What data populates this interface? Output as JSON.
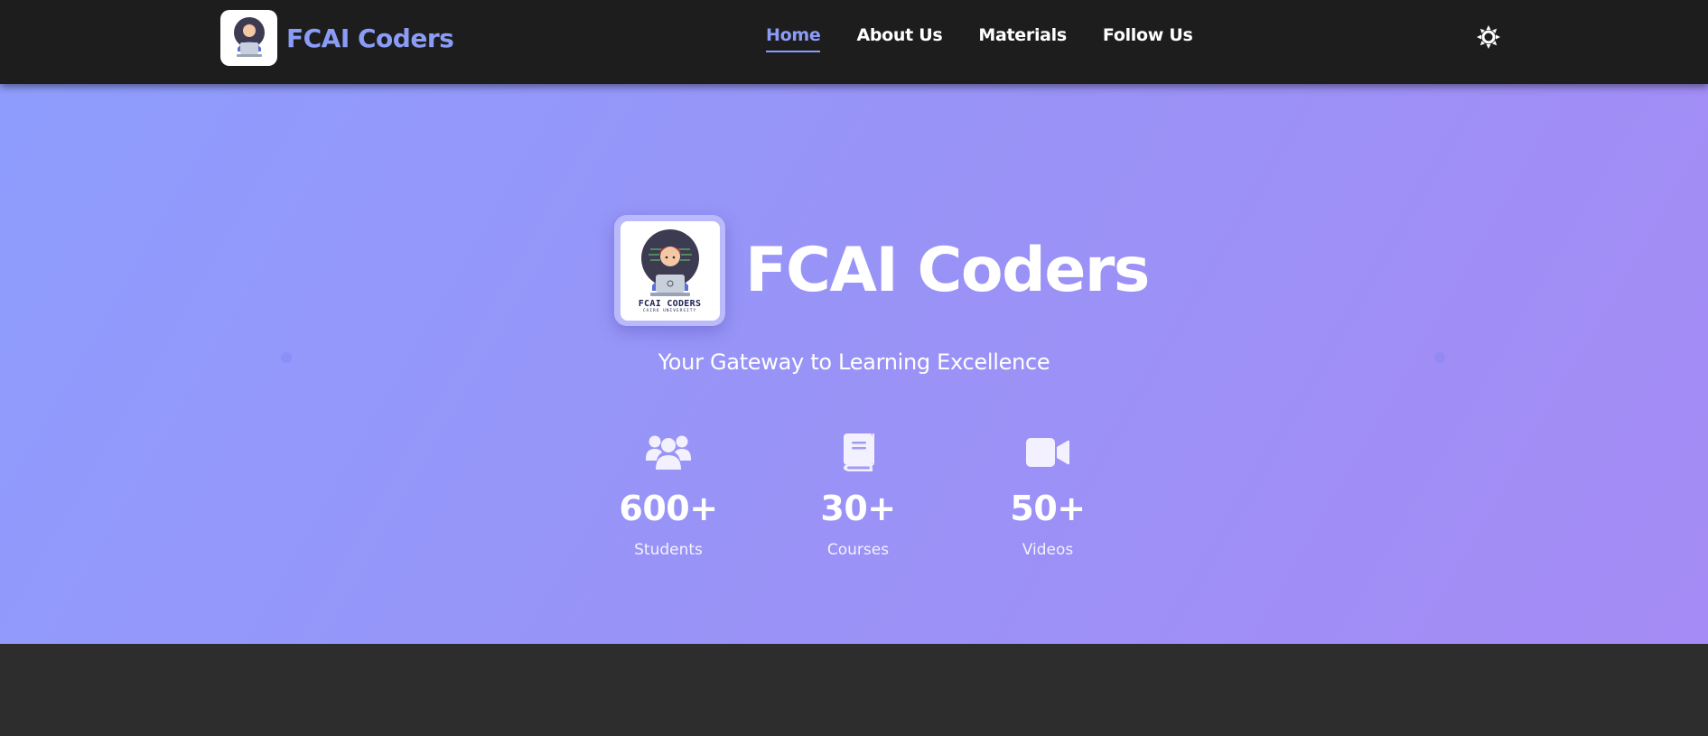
{
  "brand": {
    "name": "FCAI Coders"
  },
  "nav": {
    "items": [
      {
        "label": "Home",
        "active": true
      },
      {
        "label": "About Us",
        "active": false
      },
      {
        "label": "Materials",
        "active": false
      },
      {
        "label": "Follow Us",
        "active": false
      }
    ],
    "theme_toggle_icon": "sun-icon"
  },
  "hero": {
    "title": "FCAI Coders",
    "subtitle": "Your Gateway to Learning Excellence",
    "logo_caption": "FCAI CODERS",
    "logo_subcaption": "CAIRO UNIVERSITY",
    "stats": [
      {
        "icon": "users-icon",
        "value": "600+",
        "label": "Students"
      },
      {
        "icon": "book-icon",
        "value": "30+",
        "label": "Courses"
      },
      {
        "icon": "video-camera-icon",
        "value": "50+",
        "label": "Videos"
      }
    ]
  },
  "colors": {
    "accent": "#8b9cf7",
    "navbar_bg": "#1d1d1d",
    "hero_gradient_start": "#8e9dfd",
    "hero_gradient_end": "#a58bf5",
    "footer_bg": "#2d2d2d"
  }
}
